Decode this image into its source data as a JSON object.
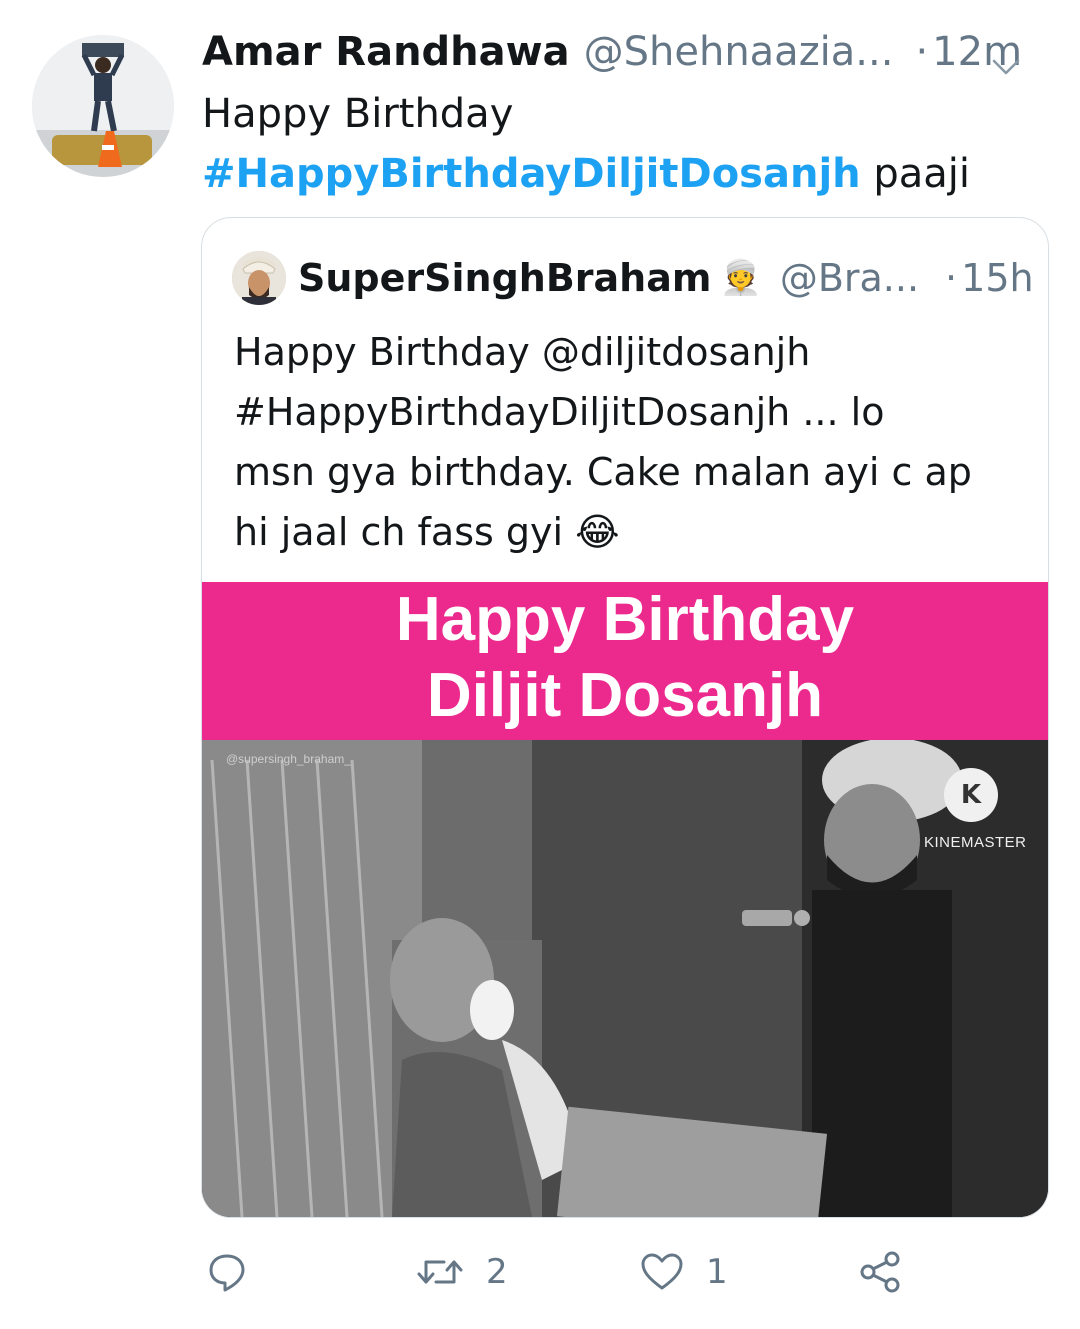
{
  "tweet": {
    "author_name": "Amar Randhawa",
    "handle": "@Shehnaazia...",
    "dot": "·",
    "time": "12m",
    "text_line1": "Happy Birthday",
    "hashtag": "#HappyBirthdayDiljitDosanjh",
    "text_after_hashtag": " paaji"
  },
  "quote": {
    "author_name": "SuperSinghBraham",
    "emoji": "👳",
    "handle": "@Bra...",
    "dot": "·",
    "time": "15h",
    "lines": [
      "Happy Birthday @diljitdosanjh",
      "#HappyBirthdayDiljitDosanjh  ... lo",
      "msn gya birthday. Cake malan ayi c ap",
      "hi jaal ch fass gyi 😂"
    ],
    "media": {
      "banner_line1": "Happy Birthday",
      "banner_line2": "Diljit Dosanjh",
      "watermark": "@supersingh_braham_",
      "app_logo_letter": "K",
      "app_name": "KINEMASTER",
      "banner_color": "#ec2a8e"
    }
  },
  "actions": {
    "reply_icon": "reply-icon",
    "retweet_count": "2",
    "like_count": "1",
    "share_icon": "share-icon"
  },
  "colors": {
    "hashtag": "#1da1f2",
    "secondary_text": "#657786",
    "primary_text": "#14171a"
  }
}
